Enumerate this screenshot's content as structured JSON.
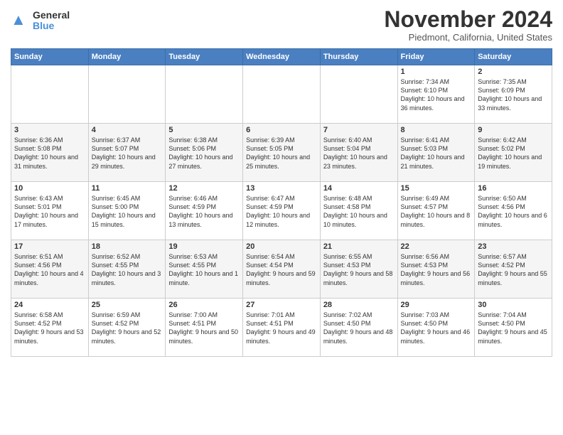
{
  "header": {
    "logo_general": "General",
    "logo_blue": "Blue",
    "title": "November 2024",
    "location": "Piedmont, California, United States"
  },
  "days_of_week": [
    "Sunday",
    "Monday",
    "Tuesday",
    "Wednesday",
    "Thursday",
    "Friday",
    "Saturday"
  ],
  "weeks": [
    [
      {
        "day": "",
        "info": ""
      },
      {
        "day": "",
        "info": ""
      },
      {
        "day": "",
        "info": ""
      },
      {
        "day": "",
        "info": ""
      },
      {
        "day": "",
        "info": ""
      },
      {
        "day": "1",
        "info": "Sunrise: 7:34 AM\nSunset: 6:10 PM\nDaylight: 10 hours\nand 36 minutes."
      },
      {
        "day": "2",
        "info": "Sunrise: 7:35 AM\nSunset: 6:09 PM\nDaylight: 10 hours\nand 33 minutes."
      }
    ],
    [
      {
        "day": "3",
        "info": "Sunrise: 6:36 AM\nSunset: 5:08 PM\nDaylight: 10 hours\nand 31 minutes."
      },
      {
        "day": "4",
        "info": "Sunrise: 6:37 AM\nSunset: 5:07 PM\nDaylight: 10 hours\nand 29 minutes."
      },
      {
        "day": "5",
        "info": "Sunrise: 6:38 AM\nSunset: 5:06 PM\nDaylight: 10 hours\nand 27 minutes."
      },
      {
        "day": "6",
        "info": "Sunrise: 6:39 AM\nSunset: 5:05 PM\nDaylight: 10 hours\nand 25 minutes."
      },
      {
        "day": "7",
        "info": "Sunrise: 6:40 AM\nSunset: 5:04 PM\nDaylight: 10 hours\nand 23 minutes."
      },
      {
        "day": "8",
        "info": "Sunrise: 6:41 AM\nSunset: 5:03 PM\nDaylight: 10 hours\nand 21 minutes."
      },
      {
        "day": "9",
        "info": "Sunrise: 6:42 AM\nSunset: 5:02 PM\nDaylight: 10 hours\nand 19 minutes."
      }
    ],
    [
      {
        "day": "10",
        "info": "Sunrise: 6:43 AM\nSunset: 5:01 PM\nDaylight: 10 hours\nand 17 minutes."
      },
      {
        "day": "11",
        "info": "Sunrise: 6:45 AM\nSunset: 5:00 PM\nDaylight: 10 hours\nand 15 minutes."
      },
      {
        "day": "12",
        "info": "Sunrise: 6:46 AM\nSunset: 4:59 PM\nDaylight: 10 hours\nand 13 minutes."
      },
      {
        "day": "13",
        "info": "Sunrise: 6:47 AM\nSunset: 4:59 PM\nDaylight: 10 hours\nand 12 minutes."
      },
      {
        "day": "14",
        "info": "Sunrise: 6:48 AM\nSunset: 4:58 PM\nDaylight: 10 hours\nand 10 minutes."
      },
      {
        "day": "15",
        "info": "Sunrise: 6:49 AM\nSunset: 4:57 PM\nDaylight: 10 hours\nand 8 minutes."
      },
      {
        "day": "16",
        "info": "Sunrise: 6:50 AM\nSunset: 4:56 PM\nDaylight: 10 hours\nand 6 minutes."
      }
    ],
    [
      {
        "day": "17",
        "info": "Sunrise: 6:51 AM\nSunset: 4:56 PM\nDaylight: 10 hours\nand 4 minutes."
      },
      {
        "day": "18",
        "info": "Sunrise: 6:52 AM\nSunset: 4:55 PM\nDaylight: 10 hours\nand 3 minutes."
      },
      {
        "day": "19",
        "info": "Sunrise: 6:53 AM\nSunset: 4:55 PM\nDaylight: 10 hours\nand 1 minute."
      },
      {
        "day": "20",
        "info": "Sunrise: 6:54 AM\nSunset: 4:54 PM\nDaylight: 9 hours\nand 59 minutes."
      },
      {
        "day": "21",
        "info": "Sunrise: 6:55 AM\nSunset: 4:53 PM\nDaylight: 9 hours\nand 58 minutes."
      },
      {
        "day": "22",
        "info": "Sunrise: 6:56 AM\nSunset: 4:53 PM\nDaylight: 9 hours\nand 56 minutes."
      },
      {
        "day": "23",
        "info": "Sunrise: 6:57 AM\nSunset: 4:52 PM\nDaylight: 9 hours\nand 55 minutes."
      }
    ],
    [
      {
        "day": "24",
        "info": "Sunrise: 6:58 AM\nSunset: 4:52 PM\nDaylight: 9 hours\nand 53 minutes."
      },
      {
        "day": "25",
        "info": "Sunrise: 6:59 AM\nSunset: 4:52 PM\nDaylight: 9 hours\nand 52 minutes."
      },
      {
        "day": "26",
        "info": "Sunrise: 7:00 AM\nSunset: 4:51 PM\nDaylight: 9 hours\nand 50 minutes."
      },
      {
        "day": "27",
        "info": "Sunrise: 7:01 AM\nSunset: 4:51 PM\nDaylight: 9 hours\nand 49 minutes."
      },
      {
        "day": "28",
        "info": "Sunrise: 7:02 AM\nSunset: 4:50 PM\nDaylight: 9 hours\nand 48 minutes."
      },
      {
        "day": "29",
        "info": "Sunrise: 7:03 AM\nSunset: 4:50 PM\nDaylight: 9 hours\nand 46 minutes."
      },
      {
        "day": "30",
        "info": "Sunrise: 7:04 AM\nSunset: 4:50 PM\nDaylight: 9 hours\nand 45 minutes."
      }
    ]
  ]
}
